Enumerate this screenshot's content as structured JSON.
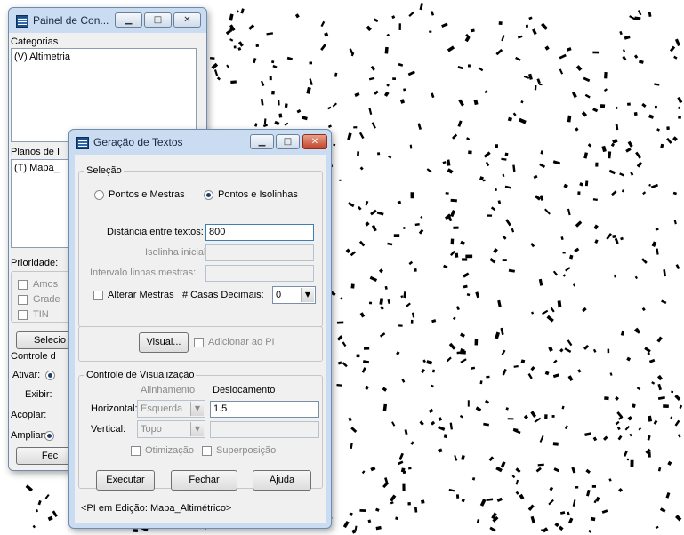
{
  "colors": {
    "titlebar": "#c9dcf1",
    "close_button": "#c2432a",
    "window_bg": "#f0f0f0"
  },
  "painel": {
    "title": "Painel de Con...",
    "categories_label": "Categorias",
    "categories": [
      "(V) Altimetria"
    ],
    "planes_label": "Planos de I",
    "planes": [
      "(T) Mapa_"
    ],
    "priority_label": "Prioridade:",
    "checkboxes": [
      "Amos",
      "Grade",
      "TIN"
    ],
    "select_button": "Selecio",
    "control_label": "Controle d",
    "activate_label": "Ativar:",
    "show_label": "Exibir:",
    "couple_label": "Acoplar:",
    "zoom_label": "Ampliar:",
    "close_button": "Fec"
  },
  "dialog": {
    "title": "Geração de Textos",
    "selection_group": "Seleção",
    "radio_points_masters": "Pontos e Mestras",
    "radio_points_isolines": "Pontos e Isolinhas",
    "distance_label": "Distância entre textos:",
    "distance_value": "800",
    "initial_isoline_label": "Isolinha inicial:",
    "master_interval_label": "Intervalo linhas mestras:",
    "alter_masters_label": "Alterar Mestras",
    "decimals_label": "# Casas Decimais:",
    "decimals_value": "0",
    "visual_button": "Visual...",
    "add_pi_label": "Adicionar ao PI",
    "viz_group": "Controle de Visualização",
    "alignment_header": "Alinhamento",
    "offset_header": "Deslocamento",
    "horizontal_label": "Horizontal:",
    "horizontal_value": "Esquerda",
    "horizontal_offset": "1.5",
    "vertical_label": "Vertical:",
    "vertical_value": "Topo",
    "vertical_offset": "",
    "optimization_label": "Otimização",
    "overlap_label": "Superposição",
    "execute_button": "Executar",
    "close_button": "Fechar",
    "help_button": "Ajuda",
    "status": "<PI em Edição: Mapa_Altimétrico>"
  },
  "icons": [
    "app-icon",
    "minimize-icon",
    "maximize-icon",
    "close-icon",
    "dropdown-arrow-icon"
  ]
}
